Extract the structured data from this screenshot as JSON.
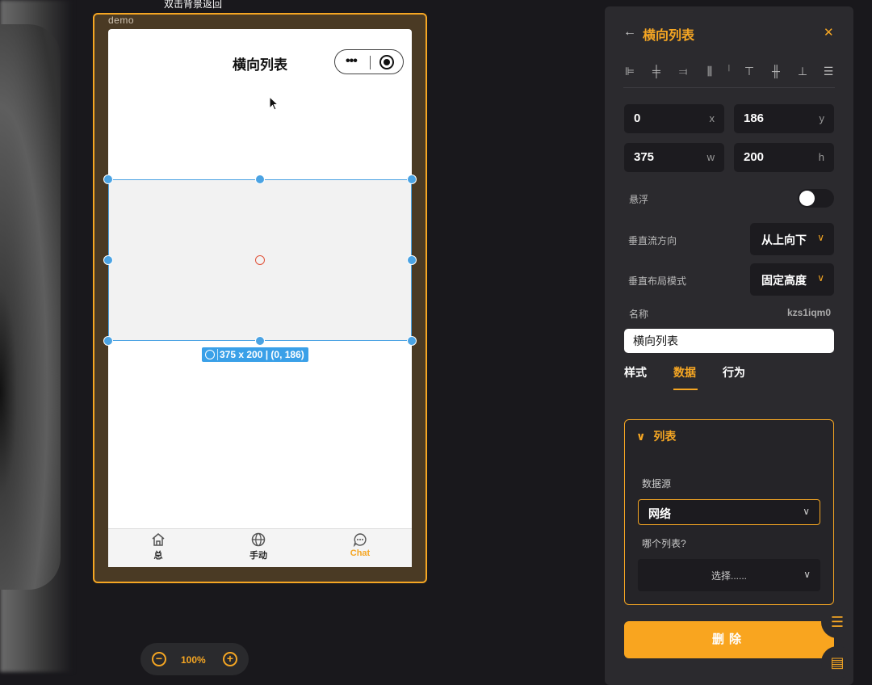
{
  "canvas": {
    "hint": "双击背景返回",
    "frame_label": "demo",
    "zoom": "100%"
  },
  "phone": {
    "title": "横向列表",
    "selection_size": "375 x 200 | (0, 186)",
    "tabs": [
      {
        "label": "总",
        "icon": "home-icon",
        "active": false
      },
      {
        "label": "手动",
        "icon": "globe-icon",
        "active": false
      },
      {
        "label": "Chat",
        "icon": "chat-icon",
        "active": true
      }
    ]
  },
  "panel": {
    "title": "横向列表",
    "x": "0",
    "x_unit": "x",
    "y": "186",
    "y_unit": "y",
    "w": "375",
    "w_unit": "w",
    "h": "200",
    "h_unit": "h",
    "float_label": "悬浮",
    "float_on": false,
    "vflow_label": "垂直流方向",
    "vflow_value": "从上向下",
    "vlayout_label": "垂直布局模式",
    "vlayout_value": "固定高度",
    "name_label": "名称",
    "name_id": "kzs1iqm0",
    "name_value": "横向列表",
    "tabs": [
      "样式",
      "数据",
      "行为"
    ],
    "active_tab": "数据",
    "section_title": "列表",
    "datasource_label": "数据源",
    "datasource_value": "网络",
    "which_list_label": "哪个列表?",
    "which_list_value": "选择......",
    "delete_label": "删除"
  },
  "colors": {
    "accent": "#f5a623",
    "selection": "#4ba3e3",
    "panel_bg": "#2b2a2e",
    "canvas_bg": "#19181c"
  }
}
